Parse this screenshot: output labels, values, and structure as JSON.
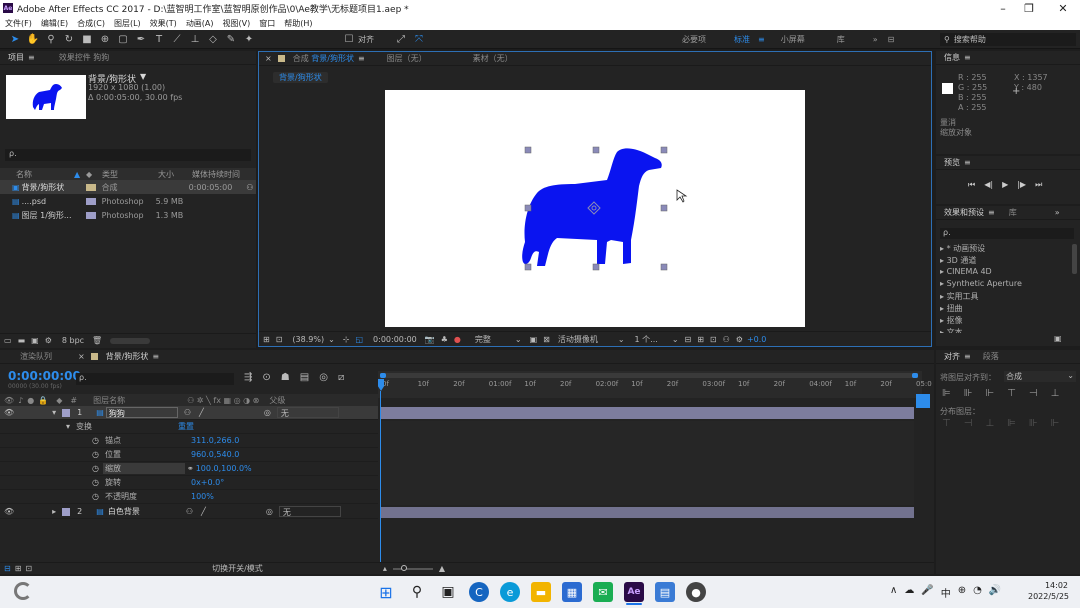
{
  "window": {
    "title": "Adobe After Effects CC 2017 - D:\\蓝智明工作室\\蓝智明原创作品\\0\\Ae教学\\无标题项目1.aep *",
    "app_icon": "Ae"
  },
  "menu": [
    "文件(F)",
    "编辑(E)",
    "合成(C)",
    "图层(L)",
    "效果(T)",
    "动画(A)",
    "视图(V)",
    "窗口",
    "帮助(H)"
  ],
  "toolbar": {
    "align_label": "对齐",
    "workspaces": [
      "必要项",
      "标准",
      "小屏幕",
      "库"
    ],
    "active_workspace": "标准",
    "search_placeholder": "搜索帮助"
  },
  "project": {
    "tab_project": "项目",
    "tab_effects_controls": "效果控件 狗狗",
    "item_name": "背景/狗形状",
    "item_size": "1920 x 1080 (1.00)",
    "item_duration": "Δ 0:00:05:00, 30.00 fps",
    "columns": [
      "名称",
      "类型",
      "大小",
      "媒体持续时间"
    ],
    "items": [
      {
        "name": "背景/狗形状",
        "type": "合成",
        "size": "",
        "duration": "0:00:05:00"
      },
      {
        "name": "....psd",
        "type": "Photoshop",
        "size": "5.9 MB",
        "duration": ""
      },
      {
        "name": "图层 1/狗形...",
        "type": "Photoshop",
        "size": "1.3 MB",
        "duration": ""
      }
    ],
    "bpc": "8 bpc"
  },
  "composition": {
    "tab_comp": "合成",
    "comp_name": "背景/狗形状",
    "tab_layer": "图层（无）",
    "tab_footage": "素材（无）",
    "breadcrumb": "背景/狗形状",
    "zoom": "(38.9%)",
    "timecode": "0:00:00:00",
    "quality": "完整",
    "camera": "活动摄像机",
    "views": "1 个...",
    "exposure": "+0.0"
  },
  "info": {
    "title": "信息",
    "r": "R : 255",
    "g": "G : 255",
    "b": "B : 255",
    "a": "A : 255",
    "x": "X : 1357",
    "y": "Y : 480",
    "line1": "量消",
    "line2": "缩放对象"
  },
  "preview": {
    "title": "预览"
  },
  "effects": {
    "title": "效果和预设",
    "tab_lib": "库",
    "search_placeholder": "ρ.",
    "items": [
      "* 动画预设",
      "3D 通道",
      "CINEMA 4D",
      "Synthetic Aperture",
      "实用工具",
      "扭曲",
      "抠像",
      "文本"
    ]
  },
  "align": {
    "title": "对齐",
    "tab2": "段落",
    "align_to_label": "将图层对齐到：",
    "align_to_value": "合成",
    "distribute_label": "分布图层："
  },
  "timeline": {
    "tab_render": "渲染队列",
    "tab_comp": "背景/狗形状",
    "timecode": "0:00:00:00",
    "frame_info": "00000 (30.00 fps)",
    "col_num": "#",
    "col_name": "图层名称",
    "col_parent": "父级",
    "ruler": [
      "0f",
      "10f",
      "20f",
      "01:00f",
      "10f",
      "20f",
      "02:00f",
      "10f",
      "20f",
      "03:00f",
      "10f",
      "20f",
      "04:00f",
      "10f",
      "20f",
      "05:0"
    ],
    "layer1": {
      "num": "1",
      "name": "狗狗",
      "parent": "无"
    },
    "transform": "变换",
    "reset": "重置",
    "props": [
      {
        "name": "锚点",
        "value": "311.0,266.0"
      },
      {
        "name": "位置",
        "value": "960.0,540.0"
      },
      {
        "name": "缩放",
        "value": "100.0,100.0%"
      },
      {
        "name": "旋转",
        "value": "0x+0.0°"
      },
      {
        "name": "不透明度",
        "value": "100%"
      }
    ],
    "layer2": {
      "num": "2",
      "name": "白色背景",
      "parent": "无"
    },
    "toggle_label": "切换开关/模式"
  },
  "taskbar": {
    "time": "14:02",
    "date": "2022/5/25",
    "ime": "中"
  },
  "colors": {
    "accent": "#2d8ceb",
    "dog": "#0a14f0",
    "panel": "#232323",
    "taskbar": "#eef0f4"
  }
}
